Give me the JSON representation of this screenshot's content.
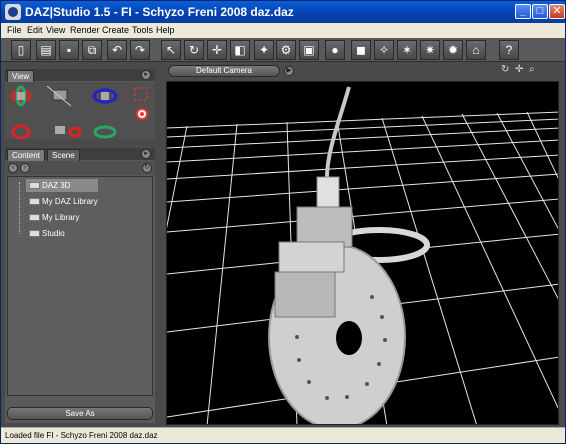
{
  "window": {
    "title": "DAZ|Studio 1.5 - FI - Schyzo Freni 2008 daz.daz",
    "min_glyph": "_",
    "max_glyph": "□",
    "close_glyph": "✕"
  },
  "menu": [
    "File",
    "Edit",
    "View",
    "Render",
    "Create",
    "Tools",
    "Help"
  ],
  "toolbar": {
    "buttons": [
      {
        "name": "new-scene-icon",
        "glyph": "▯"
      },
      {
        "name": "open-icon",
        "glyph": "▤"
      },
      {
        "name": "save-icon",
        "glyph": "▪"
      },
      {
        "name": "merge-icon",
        "glyph": "⧉"
      },
      {
        "name": "undo-icon",
        "glyph": "↶"
      },
      {
        "name": "redo-icon",
        "glyph": "↷"
      },
      {
        "name": "select-icon",
        "glyph": "↖"
      },
      {
        "name": "rotate-icon",
        "glyph": "↻"
      },
      {
        "name": "translate-icon",
        "glyph": "✛"
      },
      {
        "name": "scale-icon",
        "glyph": "◧"
      },
      {
        "name": "render-icon",
        "glyph": "✦"
      },
      {
        "name": "render-settings-icon",
        "glyph": "⚙"
      },
      {
        "name": "render-window-icon",
        "glyph": "▣"
      },
      {
        "name": "sphere-icon",
        "glyph": "●"
      },
      {
        "name": "create-primitive-icon",
        "glyph": "◼"
      },
      {
        "name": "spot-light-icon",
        "glyph": "✧"
      },
      {
        "name": "point-light-icon",
        "glyph": "✶"
      },
      {
        "name": "distant-light-icon",
        "glyph": "✷"
      },
      {
        "name": "ambient-light-icon",
        "glyph": "✹"
      },
      {
        "name": "camera-icon",
        "glyph": "⌂"
      },
      {
        "name": "help-icon",
        "glyph": "?"
      }
    ]
  },
  "view_panel": {
    "tab": "View"
  },
  "content_panel": {
    "tabs": [
      "Content",
      "Scene"
    ],
    "tree": [
      "DAZ 3D",
      "My DAZ Library",
      "My Library",
      "Studio"
    ],
    "save_as": "Save As",
    "nav_back": "‹",
    "nav_fwd": "›",
    "nav_refresh": "↻"
  },
  "viewport": {
    "camera": "Default Camera",
    "play_glyph": "▶",
    "controls": [
      "↻",
      "✛",
      "⌕"
    ],
    "arrow_glyph": "▸"
  },
  "status": {
    "text": "Loaded file FI - Schyzo Freni 2008 daz.daz"
  },
  "colors": {
    "title_bar": "#0a5fd8",
    "panel": "#5a5a5a",
    "viewport_bg": "#000000",
    "grid": "#ffffff"
  }
}
